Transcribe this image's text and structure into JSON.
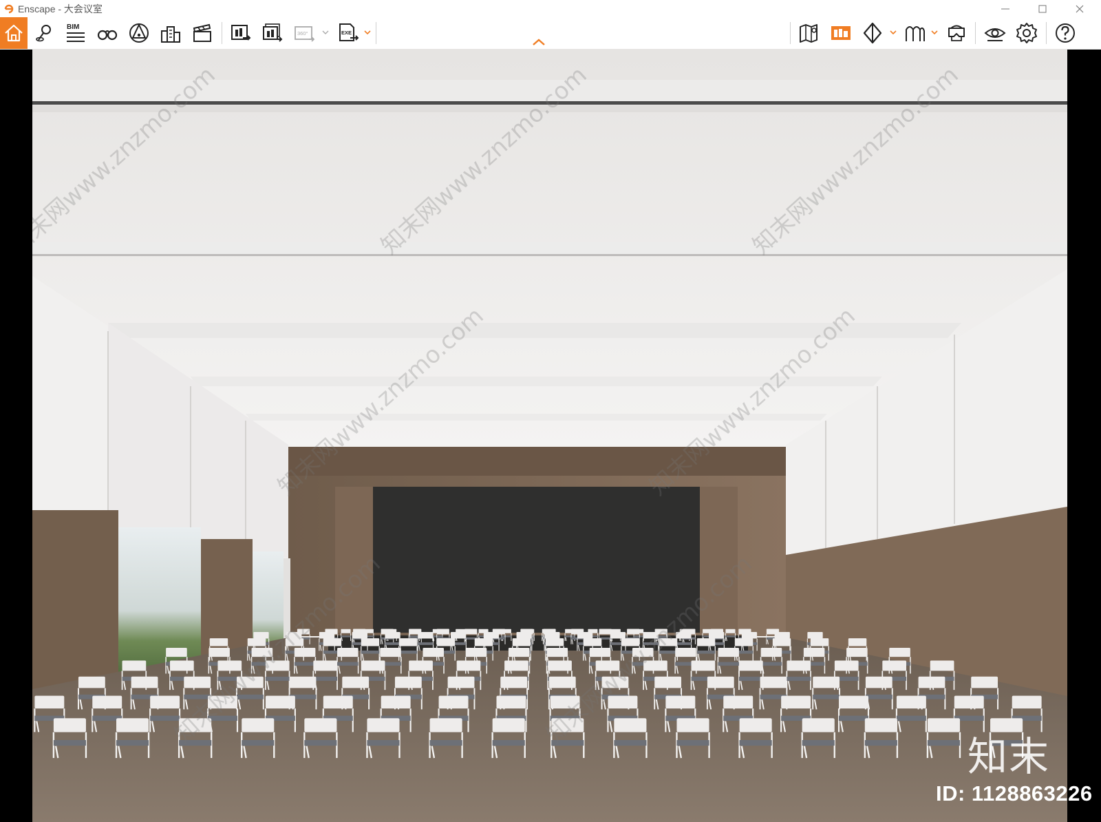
{
  "window": {
    "title": "Enscape - 大会议室",
    "controls": [
      "minimize",
      "maximize",
      "close"
    ]
  },
  "toolbar": {
    "bim_label": "BIM",
    "panorama_label": "360°",
    "exe_label": "EXE",
    "accent_color": "#f07d23",
    "left_tools": [
      "home-icon",
      "location-pin-icon",
      "bim-icon",
      "binoculars-icon",
      "bell-icon",
      "buildings-icon",
      "clapperboard-icon",
      "screenshot-export-icon",
      "batch-export-icon",
      "panorama-360-icon",
      "exe-export-icon"
    ],
    "right_tools": [
      "map-icon",
      "asset-library-icon",
      "cube-icon",
      "atlas-icon",
      "vr-headset-icon",
      "eye-icon",
      "gear-icon",
      "help-icon"
    ],
    "collapse_icon": "chevron-up-icon"
  },
  "viewport": {
    "description_free": true
  },
  "watermark": {
    "logo_text": "知末",
    "id_text": "ID: 1128863226",
    "diagonal_text": "知末网www.znzmo.com"
  }
}
